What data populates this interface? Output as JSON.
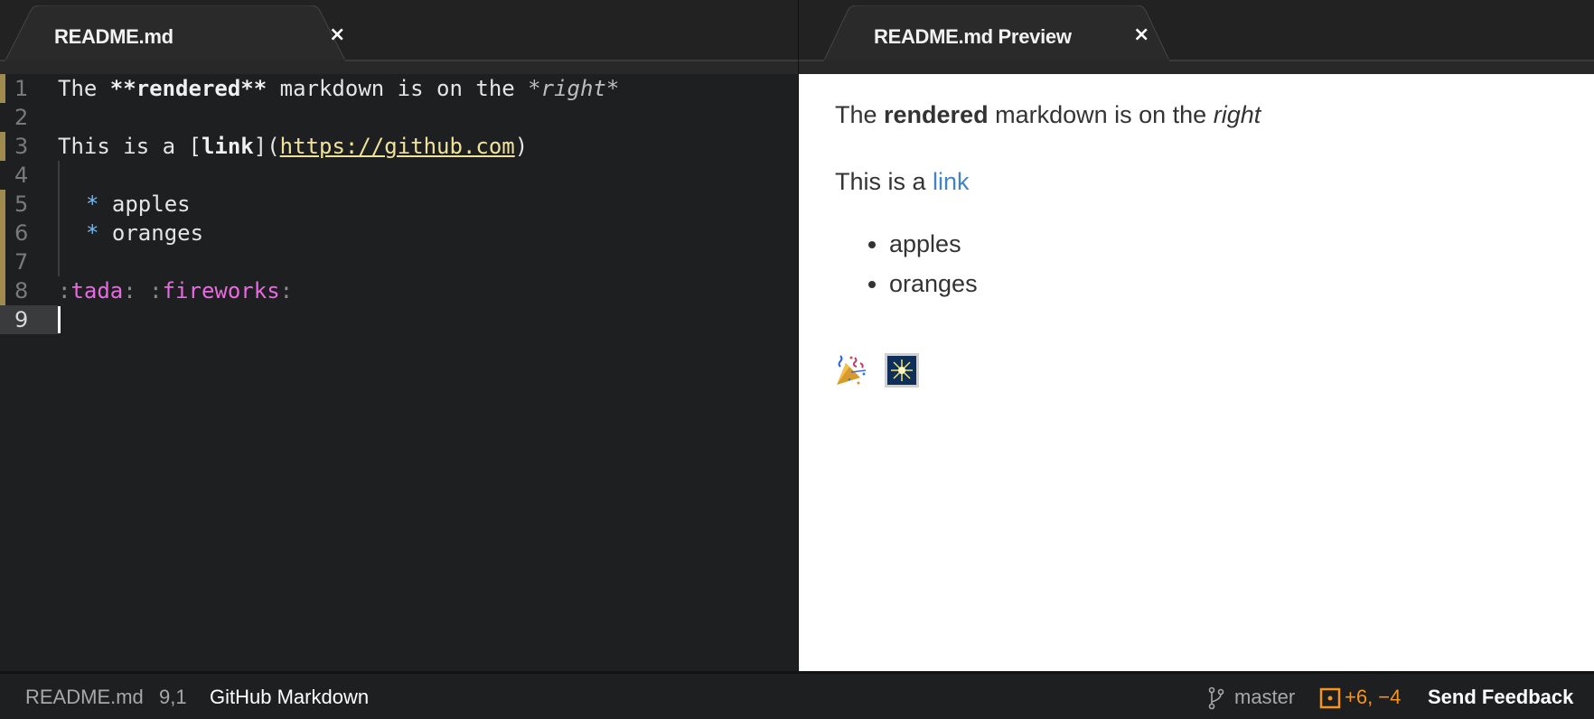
{
  "tabs": {
    "left": {
      "title": "README.md",
      "close_icon": "close-icon"
    },
    "right": {
      "title": "README.md Preview",
      "close_icon": "close-icon"
    }
  },
  "close_glyph": "×",
  "editor": {
    "lines": [
      {
        "num": "1"
      },
      {
        "num": "2"
      },
      {
        "num": "3"
      },
      {
        "num": "4"
      },
      {
        "num": "5"
      },
      {
        "num": "6"
      },
      {
        "num": "7"
      },
      {
        "num": "8"
      },
      {
        "num": "9"
      }
    ],
    "line1": {
      "a": "The ",
      "b": "**rendered**",
      "c": " markdown is on the ",
      "d": "*right*"
    },
    "line3": {
      "a": "This is a [",
      "b": "link",
      "c": "](",
      "d": "https://github.com",
      "e": ")"
    },
    "line5": {
      "bullet": "*",
      "text": " apples"
    },
    "line6": {
      "bullet": "*",
      "text": " oranges"
    },
    "line8": {
      "c1": ":",
      "e1": "tada",
      "c2": ": :",
      "e2": "fireworks",
      "c3": ":"
    }
  },
  "preview": {
    "p1": {
      "a": "The ",
      "bold": "rendered",
      "b": " markdown is on the ",
      "italic": "right"
    },
    "p2": {
      "a": "This is a ",
      "link": "link"
    },
    "list": [
      "apples",
      "oranges"
    ],
    "emojis": [
      "tada-emoji",
      "fireworks-emoji"
    ]
  },
  "statusbar": {
    "file": "README.md",
    "cursor": "9,1",
    "grammar": "GitHub Markdown",
    "branch": "master",
    "diff": "+6, −4",
    "feedback": "Send Feedback"
  },
  "colors": {
    "accent_orange": "#f7941e",
    "link_blue": "#4183c4",
    "url_yellow": "#f0e29a",
    "emoji_pink": "#e86ae0",
    "bullet_blue": "#7fb7e8"
  }
}
